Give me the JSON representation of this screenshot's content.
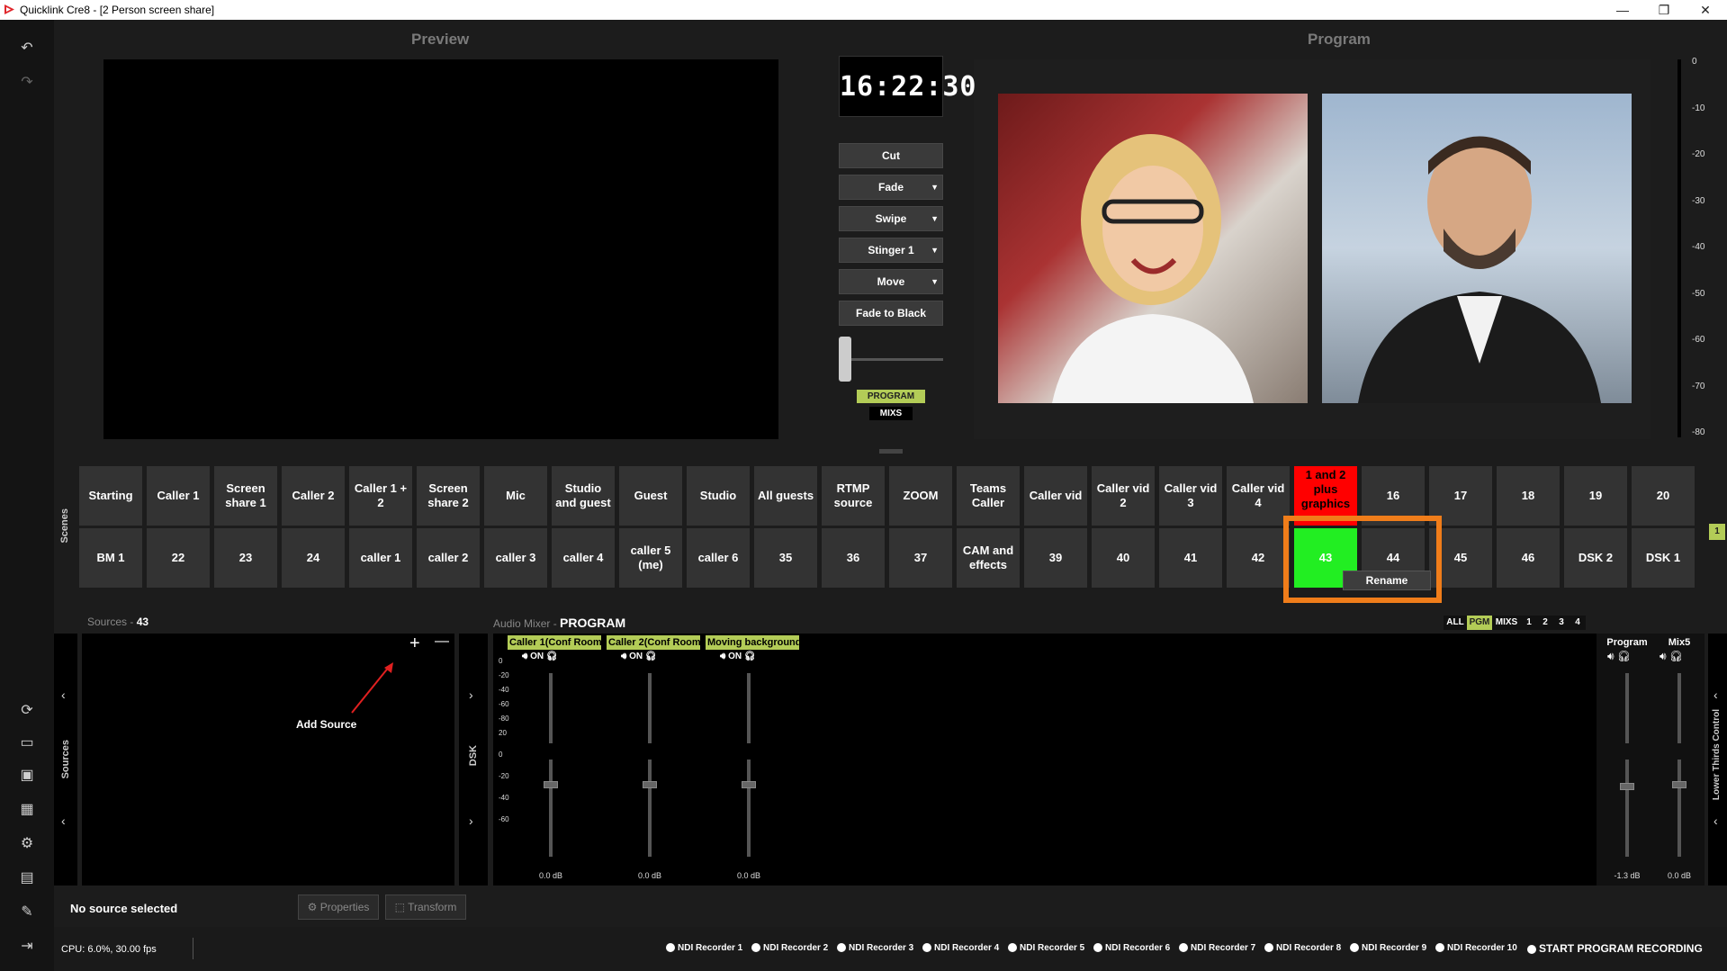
{
  "window": {
    "title": "Quicklink Cre8 - [2 Person screen share]",
    "controls": [
      "—",
      "❐",
      "✕"
    ]
  },
  "sidebar": {
    "icons": [
      "undo-icon",
      "redo-icon",
      "refresh-icon",
      "monitor-icon",
      "screen-icon",
      "grid-icon",
      "gear-icon",
      "folder-icon",
      "tools-icon",
      "exit-icon"
    ]
  },
  "preview": {
    "title": "Preview"
  },
  "program": {
    "title": "Program"
  },
  "clock": "16:22:30",
  "transitions": {
    "cut": "Cut",
    "fade": "Fade",
    "swipe": "Swipe",
    "stinger": "Stinger 1",
    "move": "Move",
    "fade_black": "Fade to Black"
  },
  "badges": {
    "program": "PROGRAM",
    "mixs": "MIXS"
  },
  "meter_ticks": [
    "0",
    "-10",
    "-20",
    "-30",
    "-40",
    "-50",
    "-60",
    "-70",
    "-80"
  ],
  "scenes": {
    "label": "Scenes",
    "row1": [
      "Starting",
      "Caller 1",
      "Screen share 1",
      "Caller 2",
      "Caller 1 + 2",
      "Screen share 2",
      "Mic",
      "Studio and guest",
      "Guest",
      "Studio",
      "All guests",
      "RTMP source",
      "ZOOM",
      "Teams Caller",
      "Caller vid",
      "Caller vid 2",
      "Caller vid 3",
      "Caller vid 4",
      "1 and 2 plus graphics",
      "16",
      "17",
      "18",
      "19",
      "20"
    ],
    "row2": [
      "BM 1",
      "22",
      "23",
      "24",
      "caller 1",
      "caller 2",
      "caller 3",
      "caller 4",
      "caller 5 (me)",
      "caller 6",
      "35",
      "36",
      "37",
      "CAM and effects",
      "39",
      "40",
      "41",
      "42",
      "43",
      "44",
      "45",
      "46",
      "DSK 2",
      "DSK 1"
    ],
    "active_row1_color": "#ff0000",
    "active_row2_color": "#22ee22",
    "page_badge": "1",
    "context_menu": "Rename"
  },
  "sources": {
    "label": "Sources",
    "scene": "43",
    "add_hint": "Add Source",
    "plus": "+",
    "minus": "—",
    "vlabel": "Sources",
    "dsk_label": "DSK",
    "status": "No source selected",
    "properties": "Properties",
    "transform": "Transform"
  },
  "audio": {
    "label": "Audio Mixer",
    "bus": "PROGRAM",
    "tabs": [
      "ALL",
      "PGM",
      "MIXS",
      "1",
      "2",
      "3",
      "4"
    ],
    "on_label": "ON",
    "channels": [
      {
        "name": "Caller 1(Conf Room",
        "db": "0.0 dB"
      },
      {
        "name": "Caller 2(Conf Room",
        "db": "0.0 dB"
      },
      {
        "name": "Moving background",
        "db": "0.0 dB"
      }
    ],
    "master": [
      {
        "name": "Program",
        "db": "-1.3 dB"
      },
      {
        "name": "Mix5",
        "db": "0.0 dB"
      }
    ],
    "scale_top": [
      "0",
      "-20",
      "-40",
      "-60",
      "-80"
    ],
    "scale_bottom": [
      "20",
      "0",
      "-20",
      "-40",
      "-60"
    ],
    "lower_thirds": "Lower Thirds Control"
  },
  "status": {
    "cpu": "CPU: 6.0%, 30.00 fps",
    "recorders": [
      "NDI Recorder 1",
      "NDI Recorder 2",
      "NDI Recorder 3",
      "NDI Recorder 4",
      "NDI Recorder 5",
      "NDI Recorder 6",
      "NDI Recorder 7",
      "NDI Recorder 8",
      "NDI Recorder 9",
      "NDI Recorder 10"
    ],
    "start_recording": "START PROGRAM RECORDING"
  }
}
